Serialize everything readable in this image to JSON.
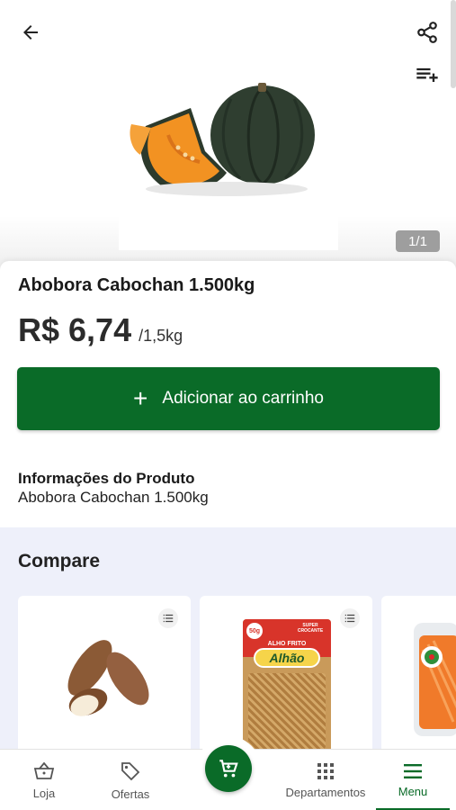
{
  "header": {
    "back_icon": "arrow-left-icon",
    "share_icon": "share-icon",
    "add_to_list_icon": "playlist-add-icon"
  },
  "gallery": {
    "counter": "1/1"
  },
  "product": {
    "title": "Abobora Cabochan 1.500kg",
    "price": "R$ 6,74",
    "unit": "/1,5kg",
    "add_button_label": "Adicionar ao carrinho",
    "info_title": "Informações do Produto",
    "info_description": "Abobora Cabochan 1.500kg"
  },
  "compare": {
    "title": "Compare",
    "cards": [
      {
        "image": "yam-image"
      },
      {
        "image": "alho-frito-package-image",
        "package_brand": "Alhão",
        "package_text_top": "ALHO FRITO",
        "package_badge": "SUPER CROCANTE",
        "package_weight": "50g"
      },
      {
        "image": "carrot-package-image"
      }
    ]
  },
  "bottom_nav": {
    "items": [
      {
        "label": "Loja",
        "icon": "basket-icon"
      },
      {
        "label": "Ofertas",
        "icon": "tag-icon"
      },
      {
        "label": "Departamentos",
        "icon": "grid-icon"
      },
      {
        "label": "Menu",
        "icon": "menu-icon",
        "active": true
      }
    ],
    "cart_icon": "cart-icon"
  },
  "colors": {
    "brand_green": "#0a6b28",
    "compare_bg": "#eef0fa"
  }
}
